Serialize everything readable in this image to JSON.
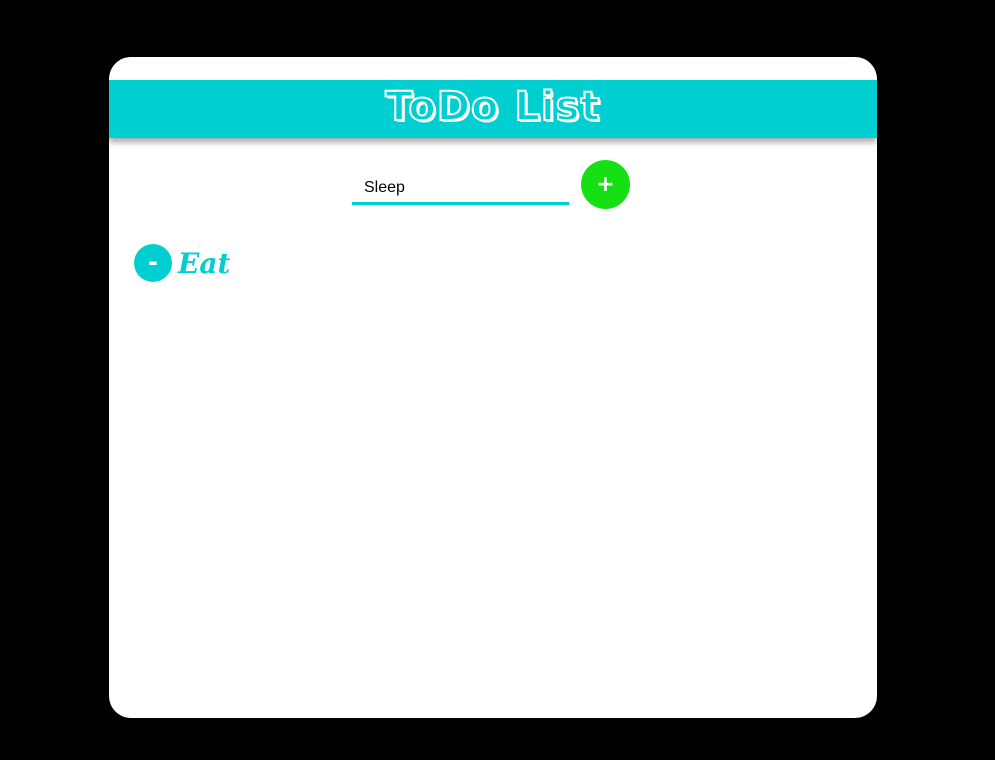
{
  "app": {
    "title": "ToDo List"
  },
  "input": {
    "value": "Sleep",
    "placeholder": ""
  },
  "buttons": {
    "add_label": "+",
    "remove_label": "-"
  },
  "todos": [
    {
      "text": "Eat"
    }
  ],
  "colors": {
    "accent": "#00cfd1",
    "add_button": "#14e014",
    "background": "#000000",
    "card": "#ffffff"
  }
}
